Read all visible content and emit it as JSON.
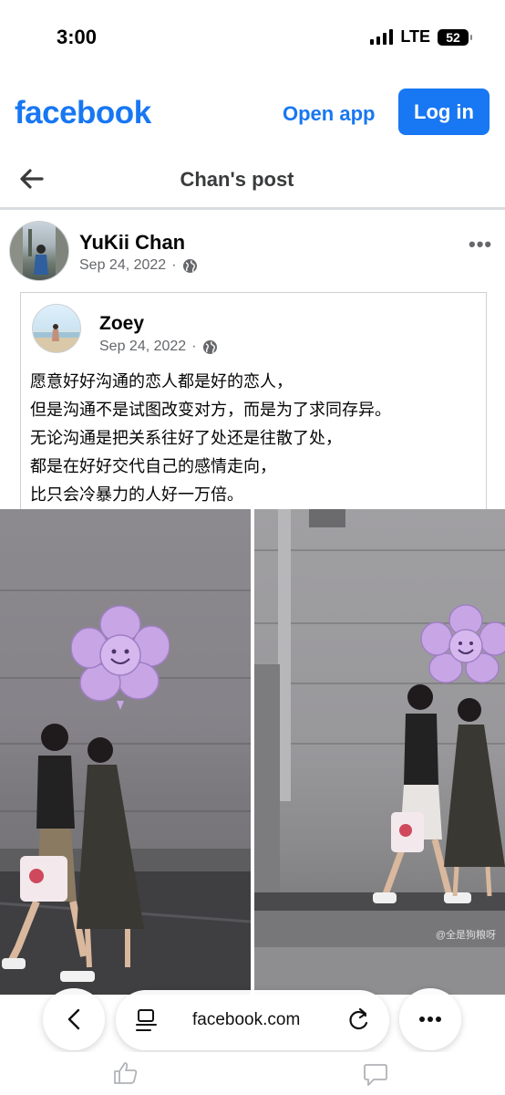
{
  "status_bar": {
    "time": "3:00",
    "network": "LTE",
    "battery": "52"
  },
  "header": {
    "logo": "facebook",
    "open_app": "Open app",
    "login": "Log in"
  },
  "title_bar": {
    "title": "Chan's post"
  },
  "post": {
    "author": "YuKii Chan",
    "date": "Sep 24, 2022",
    "privacy_icon": "globe-icon",
    "more_icon": "more-dots-icon",
    "shared": {
      "author": "Zoey",
      "date": "Sep 24, 2022",
      "privacy_icon": "globe-icon",
      "text_lines": [
        "愿意好好沟通的恋人都是好的恋人，",
        "但是沟通不是试图改变对方，而是为了求同存异。",
        "无论沟通是把关系往好了处还是往散了处，",
        "都是在好好交代自己的感情走向，",
        "比只会冷暴力的人好一万倍。"
      ]
    },
    "photo_watermark": "@全是狗粮呀"
  },
  "browser": {
    "url": "facebook.com",
    "back_icon": "chevron-left-icon",
    "reader_icon": "reader-icon",
    "reload_icon": "reload-icon",
    "menu_icon": "more-horizontal-icon"
  },
  "actions": {
    "like_icon": "thumbs-up-icon",
    "comment_icon": "comment-icon"
  },
  "colors": {
    "brand": "#1877f2",
    "secondary_text": "#65676b",
    "divider": "#dadde1"
  }
}
